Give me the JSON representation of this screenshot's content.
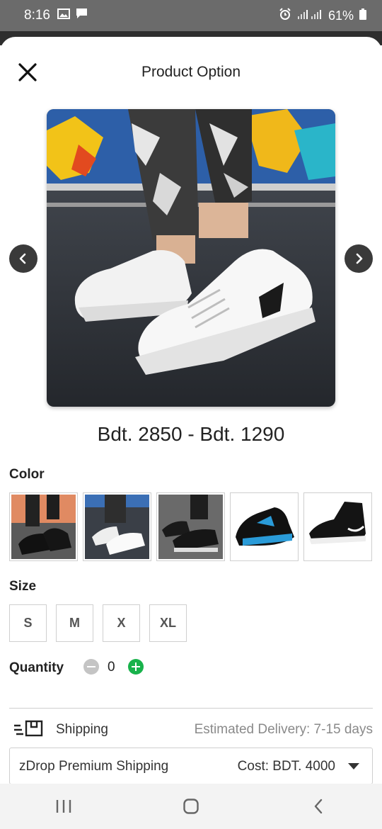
{
  "status_bar": {
    "time": "8:16",
    "battery": "61%"
  },
  "header": {
    "title": "Product Option"
  },
  "product": {
    "price": "Bdt. 2850 - Bdt. 1290"
  },
  "color": {
    "label": "Color"
  },
  "size": {
    "label": "Size",
    "options": [
      "S",
      "M",
      "X",
      "XL"
    ]
  },
  "quantity": {
    "label": "Quantity",
    "value": "0"
  },
  "shipping": {
    "label": "Shipping",
    "estimated_delivery": "Estimated Delivery: 7-15 days",
    "method": "zDrop Premium Shipping",
    "cost": "Cost: BDT. 4000"
  },
  "colors": {
    "accent_green": "#18b24b",
    "nav_button": "#3a3a3a",
    "border": "#cfcfcf"
  }
}
